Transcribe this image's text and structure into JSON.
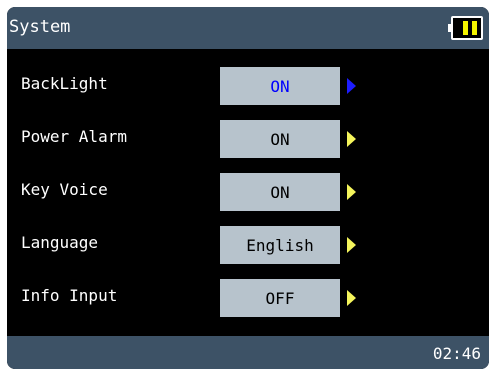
{
  "title": "System",
  "battery": {
    "icon": "battery-icon",
    "level": "2 of 2 bars"
  },
  "settings": [
    {
      "label": "BackLight",
      "value": "ON",
      "selected": true
    },
    {
      "label": "Power Alarm",
      "value": "ON",
      "selected": false
    },
    {
      "label": "Key Voice",
      "value": "ON",
      "selected": false
    },
    {
      "label": "Language",
      "value": "English",
      "selected": false
    },
    {
      "label": "Info Input",
      "value": "OFF",
      "selected": false
    }
  ],
  "status": {
    "time": "02:46"
  },
  "colors": {
    "bar_background": "#3d5266",
    "screen_background": "#000000",
    "button_background": "#b7c3cc",
    "selected_text": "#0000ff",
    "selected_arrow": "#1d1dff",
    "arrow": "#f5f55c",
    "battery_bar": "#f5f500"
  }
}
